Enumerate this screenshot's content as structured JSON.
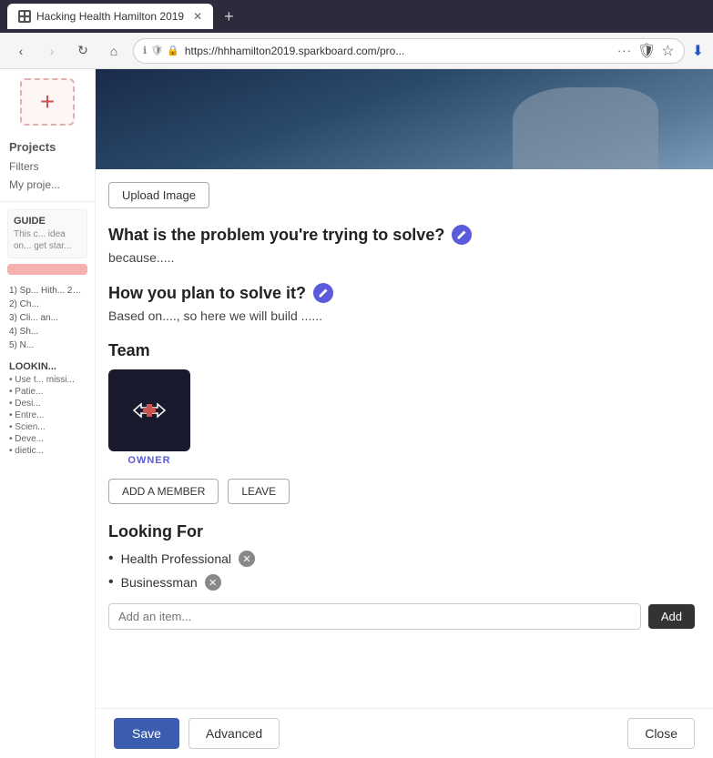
{
  "browser": {
    "tab_title": "Hacking Health Hamilton 2019",
    "url": "https://hhhamilton2019.sparkboard.com/pro...",
    "new_tab_label": "+"
  },
  "nav": {
    "back": "‹",
    "forward": "›",
    "refresh": "↻",
    "home": "⌂"
  },
  "sidebar": {
    "add_icon": "+",
    "projects_label": "Projects",
    "filters_item": "Filters",
    "my_projects_item": "My proje...",
    "guide_title": "GUIDE",
    "guide_text": "This c... idea on... get star...",
    "cta_btn": "",
    "list_items": [
      "1)  Sp... Hith... 201...",
      "2)  Ch...",
      "3)  Cli... an...",
      "4)  Sh...",
      "5)  N..."
    ],
    "looking_label": "LOOKIN...",
    "looking_items": [
      "• Use t... missi...",
      "• Patie...",
      "• Desi...",
      "• Entre...",
      "• Scien...",
      "• Deve...",
      "• dietic..."
    ]
  },
  "main": {
    "upload_image_label": "Upload Image",
    "problem_heading": "What is the problem you're trying to solve?",
    "problem_text": "because.....",
    "solution_heading": "How you plan to solve it?",
    "solution_text": "Based on...., so here we will build ......",
    "team_label": "Team",
    "owner_badge": "OWNER",
    "add_member_label": "ADD A MEMBER",
    "leave_label": "LEAVE",
    "looking_for_label": "Looking For",
    "tags": [
      {
        "label": "Health Professional",
        "removable": true
      },
      {
        "label": "Businessman",
        "removable": true
      }
    ],
    "add_item_placeholder": "Add an item...",
    "add_btn_label": "Add"
  },
  "bottom_bar": {
    "save_label": "Save",
    "advanced_label": "Advanced",
    "close_label": "Close"
  }
}
